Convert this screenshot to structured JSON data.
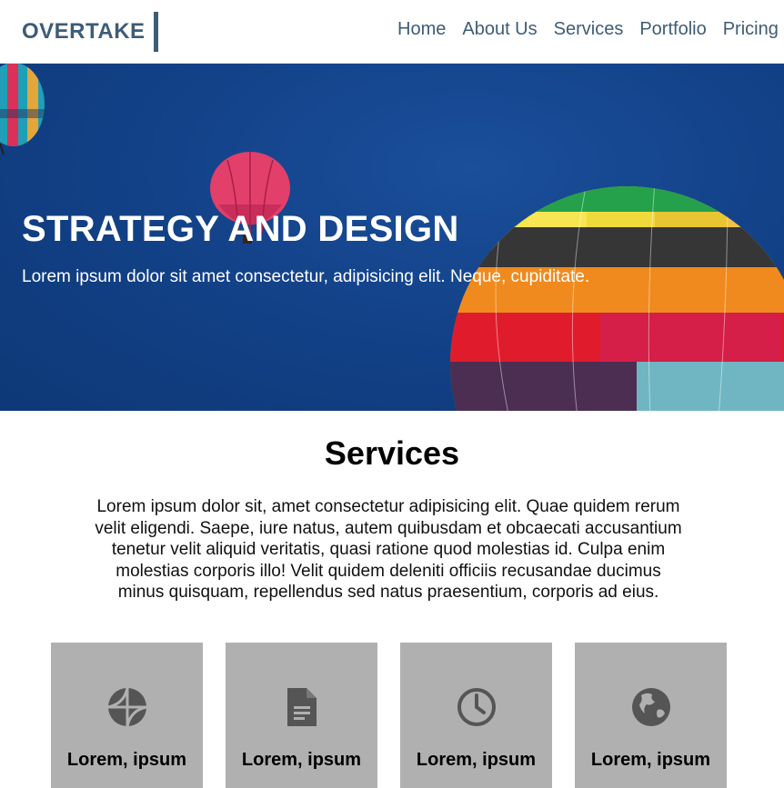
{
  "nav": {
    "logo": "OVERTAKE",
    "links": [
      "Home",
      "About Us",
      "Services",
      "Portfolio",
      "Pricing"
    ]
  },
  "hero": {
    "title": "STRATEGY AND DESIGN",
    "subtitle": "Lorem ipsum dolor sit amet consectetur, adipisicing elit. Neque, cupiditate."
  },
  "services": {
    "title": "Services",
    "description": "Lorem ipsum dolor sit, amet consectetur adipisicing elit. Quae quidem rerum velit eligendi. Saepe, iure natus, autem quibusdam et obcaecati accusantium tenetur velit aliquid veritatis, quasi ratione quod molestias id. Culpa enim molestias corporis illo! Velit quidem deleniti officiis recusandae ducimus minus quisquam, repellendus sed natus praesentium, corporis ad eius.",
    "cards": [
      {
        "icon": "basketball-icon",
        "title": "Lorem, ipsum"
      },
      {
        "icon": "document-icon",
        "title": "Lorem, ipsum"
      },
      {
        "icon": "clock-icon",
        "title": "Lorem, ipsum"
      },
      {
        "icon": "globe-icon",
        "title": "Lorem, ipsum"
      }
    ]
  },
  "colors": {
    "brand": "#3e5c76",
    "hero_sky": "#134289",
    "card_bg": "#b0b0b0",
    "icon": "#555555"
  }
}
